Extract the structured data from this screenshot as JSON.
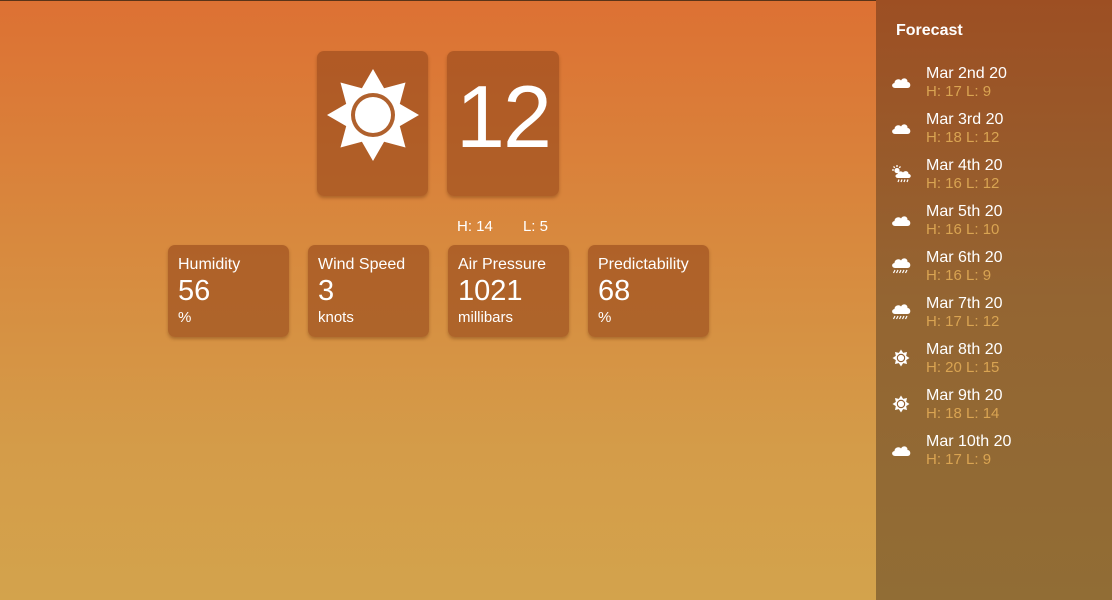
{
  "current": {
    "icon": "sun-icon",
    "temp": "12",
    "high": "H: 14",
    "low": "L: 5"
  },
  "stats": [
    {
      "label": "Humidity",
      "value": "56",
      "unit": "%"
    },
    {
      "label": "Wind Speed",
      "value": "3",
      "unit": "knots"
    },
    {
      "label": "Air Pressure",
      "value": "1021",
      "unit": "millibars"
    },
    {
      "label": "Predictability",
      "value": "68",
      "unit": "%"
    }
  ],
  "forecast": {
    "title": "Forecast",
    "days": [
      {
        "date": "Mar 2nd 20",
        "hl": "H: 17 L: 9",
        "icon": "cloud-icon"
      },
      {
        "date": "Mar 3rd 20",
        "hl": "H: 18 L: 12",
        "icon": "cloud-icon"
      },
      {
        "date": "Mar 4th 20",
        "hl": "H: 16 L: 12",
        "icon": "sun-cloud-rain-icon"
      },
      {
        "date": "Mar 5th 20",
        "hl": "H: 16 L: 10",
        "icon": "cloud-icon"
      },
      {
        "date": "Mar 6th 20",
        "hl": "H: 16 L: 9",
        "icon": "cloud-rain-icon"
      },
      {
        "date": "Mar 7th 20",
        "hl": "H: 17 L: 12",
        "icon": "cloud-rain-icon"
      },
      {
        "date": "Mar 8th 20",
        "hl": "H: 20 L: 15",
        "icon": "sun-icon"
      },
      {
        "date": "Mar 9th 20",
        "hl": "H: 18 L: 14",
        "icon": "sun-icon"
      },
      {
        "date": "Mar 10th 20",
        "hl": "H: 17 L: 9",
        "icon": "cloud-icon"
      }
    ]
  },
  "colors": {
    "forecast_hl": "#d9a452",
    "card_bg": "#96481c"
  }
}
